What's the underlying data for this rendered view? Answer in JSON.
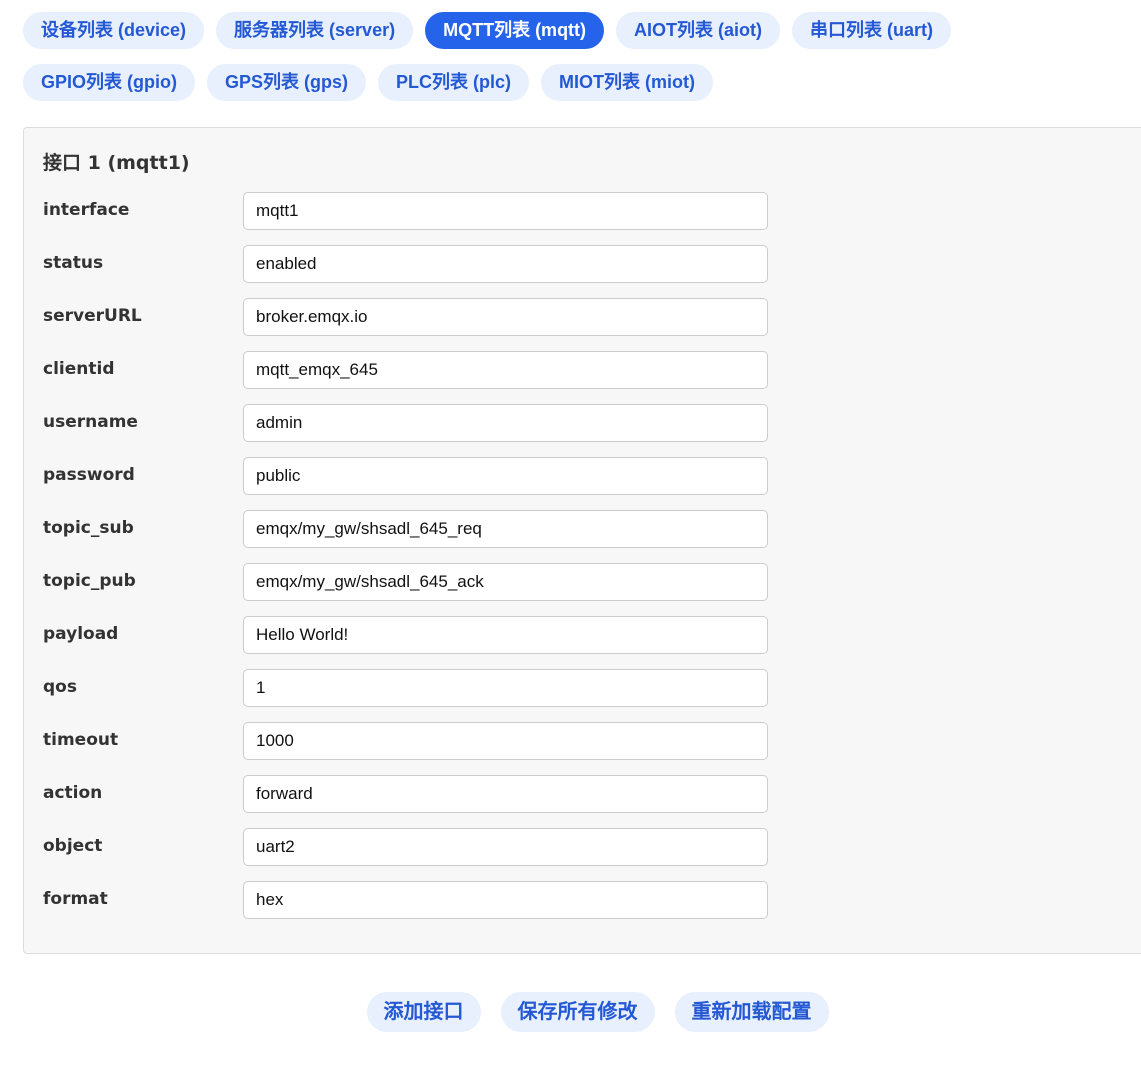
{
  "tabs": [
    {
      "label": "设备列表 (device)",
      "active": false
    },
    {
      "label": "服务器列表 (server)",
      "active": false
    },
    {
      "label": "MQTT列表 (mqtt)",
      "active": true
    },
    {
      "label": "AIOT列表 (aiot)",
      "active": false
    },
    {
      "label": "串口列表 (uart)",
      "active": false
    },
    {
      "label": "GPIO列表 (gpio)",
      "active": false
    },
    {
      "label": "GPS列表 (gps)",
      "active": false
    },
    {
      "label": "PLC列表 (plc)",
      "active": false
    },
    {
      "label": "MIOT列表 (miot)",
      "active": false
    }
  ],
  "panel": {
    "title": "接口 1 (mqtt1)",
    "fields": [
      {
        "label": "interface",
        "value": "mqtt1"
      },
      {
        "label": "status",
        "value": "enabled"
      },
      {
        "label": "serverURL",
        "value": "broker.emqx.io"
      },
      {
        "label": "clientid",
        "value": "mqtt_emqx_645"
      },
      {
        "label": "username",
        "value": "admin"
      },
      {
        "label": "password",
        "value": "public"
      },
      {
        "label": "topic_sub",
        "value": "emqx/my_gw/shsadl_645_req"
      },
      {
        "label": "topic_pub",
        "value": "emqx/my_gw/shsadl_645_ack"
      },
      {
        "label": "payload",
        "value": "Hello World!"
      },
      {
        "label": "qos",
        "value": "1"
      },
      {
        "label": "timeout",
        "value": "1000"
      },
      {
        "label": "action",
        "value": "forward"
      },
      {
        "label": "object",
        "value": "uart2"
      },
      {
        "label": "format",
        "value": "hex"
      }
    ]
  },
  "actions": {
    "add_label": "添加接口",
    "save_label": "保存所有修改",
    "reload_label": "重新加载配置"
  },
  "colors": {
    "accent": "#2563eb",
    "tab_bg": "#e8effd",
    "tab_text": "#2459d3"
  }
}
